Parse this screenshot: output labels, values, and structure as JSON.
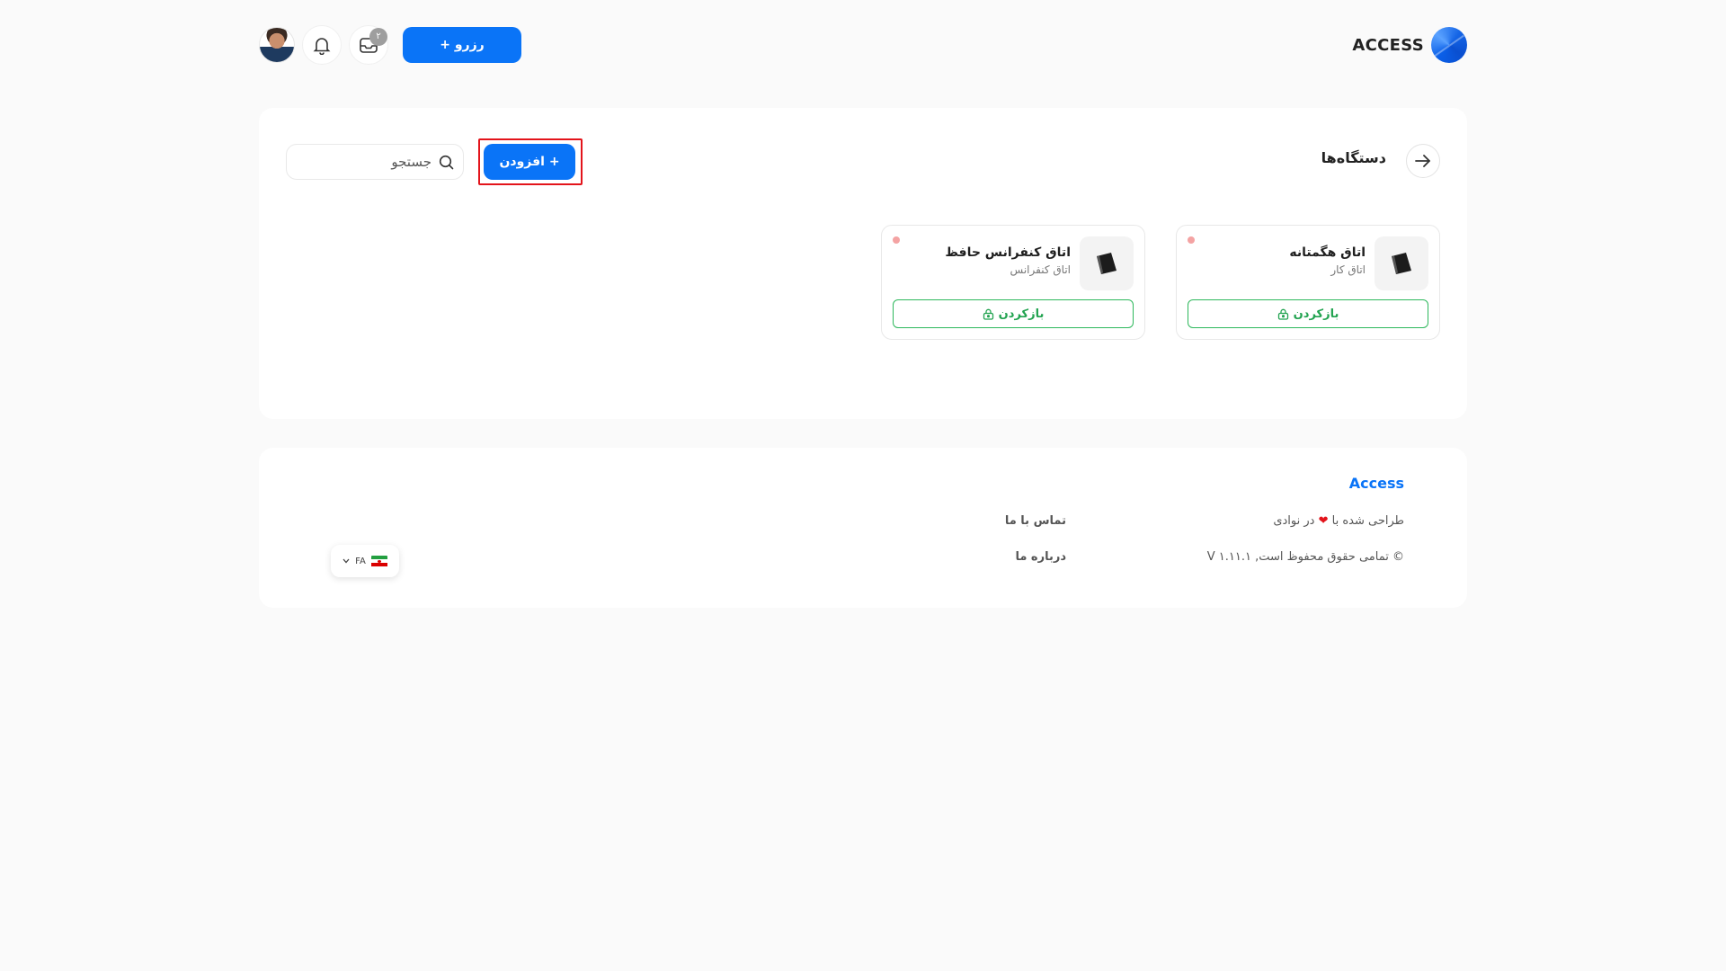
{
  "header": {
    "logo_text": "ACCESS",
    "reserve_label": "+ رزرو",
    "inbox_badge": "۲"
  },
  "main": {
    "title": "دستگاه‌ها",
    "add_label": "افزودن +",
    "search": {
      "placeholder": "جستجو",
      "value": ""
    },
    "devices": [
      {
        "name": "اتاق هگمتانه",
        "type": "اتاق کار",
        "action_label": "بازکردن",
        "status": "offline"
      },
      {
        "name": "اتاق کنفرانس حافظ",
        "type": "اتاق کنفرانس",
        "action_label": "بازکردن",
        "status": "offline"
      }
    ]
  },
  "footer": {
    "brand": "Access",
    "made_prefix": "طراحی شده با",
    "made_suffix": "در نوادی",
    "heart": "❤",
    "copyright": "© تمامی حقوق محفوظ است, V ۱.۱۱.۱",
    "contact_label": "تماس با ما",
    "about_label": "درباره ما",
    "language_code": "FA"
  },
  "colors": {
    "primary": "#0a74f7",
    "success": "#22a350",
    "highlight": "#e3141b",
    "status_offline": "#f4a3a3",
    "background": "#fafafa"
  },
  "icons": {
    "back": "arrow-right-icon",
    "search": "search-icon",
    "bell": "bell-icon",
    "inbox": "inbox-icon",
    "lock": "lock-icon",
    "chevron": "chevron-down-icon"
  }
}
